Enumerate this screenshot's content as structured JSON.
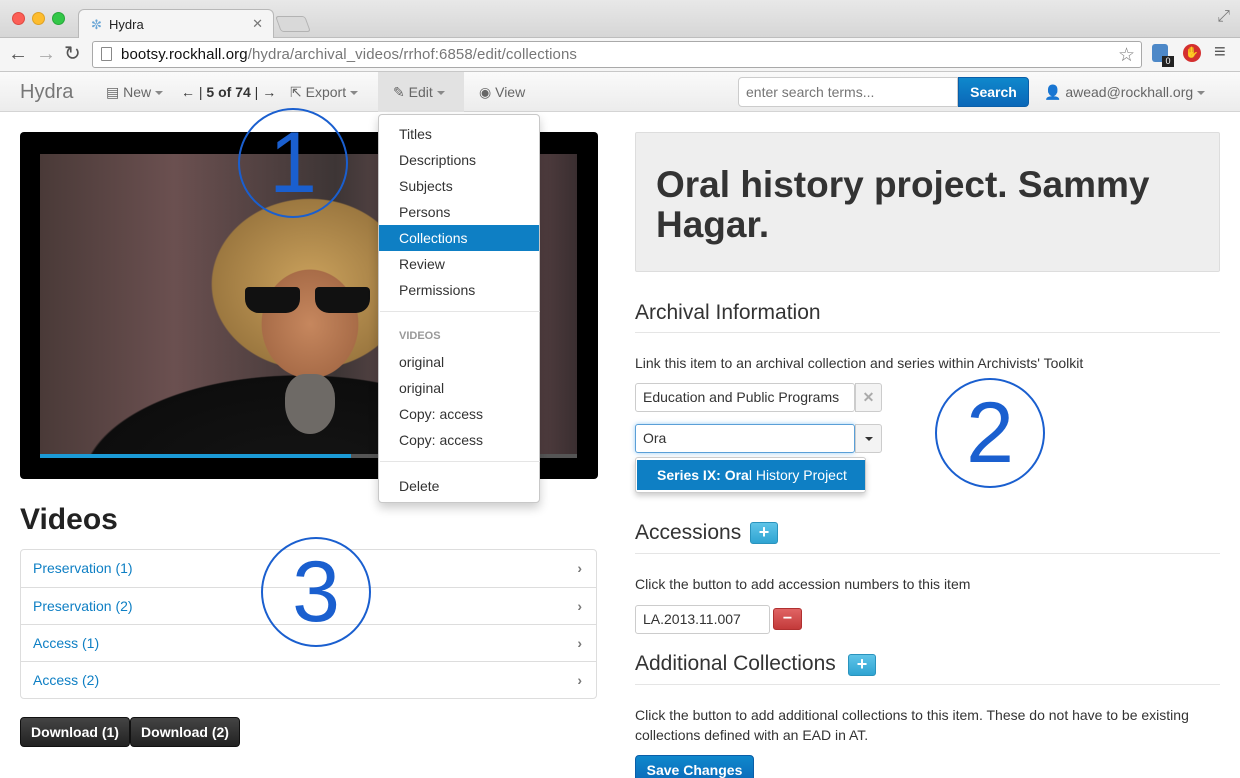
{
  "browser": {
    "tab_title": "Hydra",
    "url_host": "bootsy.rockhall.org",
    "url_path": "/hydra/archival_videos/rrhof:6858/edit/collections",
    "ext_badge": "0"
  },
  "navbar": {
    "brand": "Hydra",
    "new_label": "New",
    "pager_label": "5 of 74",
    "export_label": "Export",
    "edit_label": "Edit",
    "view_label": "View",
    "search_placeholder": "enter search terms...",
    "search_button": "Search",
    "user": "awead@rockhall.org"
  },
  "player": {
    "progress": 0.58
  },
  "edit_menu": {
    "items": [
      "Titles",
      "Descriptions",
      "Subjects",
      "Persons",
      "Collections",
      "Review",
      "Permissions"
    ],
    "active": "Collections",
    "videos_header": "VIDEOS",
    "video_items": [
      "original",
      "original",
      "Copy: access",
      "Copy: access"
    ],
    "delete_label": "Delete"
  },
  "videos": {
    "heading": "Videos",
    "items": [
      "Preservation (1)",
      "Preservation (2)",
      "Access (1)",
      "Access (2)"
    ],
    "download_1": "Download (1)",
    "download_2": "Download (2)"
  },
  "record": {
    "title": "Oral history project. Sammy Hagar."
  },
  "archival": {
    "heading": "Archival Information",
    "help": "Link this item to an archival collection and series within Archivists' Toolkit",
    "collection_value": "Education and Public Programs",
    "series_value": "Ora",
    "suggestion_prefix": "Series IX: ",
    "suggestion_match": "Ora",
    "suggestion_rest": "l History Project"
  },
  "accessions": {
    "heading": "Accessions",
    "help": "Click the button to add accession numbers to this item",
    "value": "LA.2013.11.007"
  },
  "additional": {
    "heading": "Additional Collections",
    "help": "Click the button to add additional collections to this item. These do not have to be existing collections defined with an EAD in AT.",
    "save_label": "Save Changes"
  },
  "annotations": [
    "1",
    "2",
    "3"
  ],
  "colors": {
    "accent": "#0e7fc4",
    "annotation": "#1a5fcf",
    "danger": "#c33a3a"
  }
}
